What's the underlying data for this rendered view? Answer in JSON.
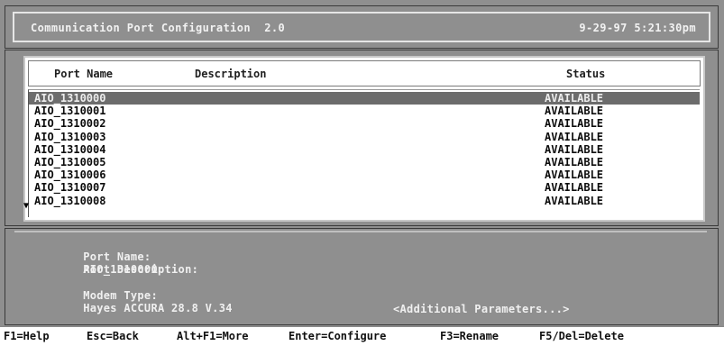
{
  "title": {
    "app": "Communication Port Configuration  2.0",
    "datetime": "9-29-97 5:21:30pm"
  },
  "list": {
    "headers": {
      "port_name": "Port Name",
      "description": "Description",
      "status": "Status"
    },
    "rows": [
      {
        "port_name": "AIO_1310000",
        "status": "AVAILABLE",
        "selected": true
      },
      {
        "port_name": "AIO_1310001",
        "status": "AVAILABLE"
      },
      {
        "port_name": "AIO_1310002",
        "status": "AVAILABLE"
      },
      {
        "port_name": "AIO_1310003",
        "status": "AVAILABLE"
      },
      {
        "port_name": "AIO_1310004",
        "status": "AVAILABLE"
      },
      {
        "port_name": "AIO_1310005",
        "status": "AVAILABLE"
      },
      {
        "port_name": "AIO_1310006",
        "status": "AVAILABLE"
      },
      {
        "port_name": "AIO_1310007",
        "status": "AVAILABLE"
      },
      {
        "port_name": "AIO_1310008",
        "status": "AVAILABLE"
      }
    ],
    "scroll_icon": "down-triangle-icon"
  },
  "detail": {
    "port_name_label": "Port Name:",
    "port_name_value": "AIO_1310000",
    "port_description_label": "Port Description:",
    "modem_type_label": "Modem Type:",
    "modem_type_value": "Hayes ACCURA 28.8 V.34",
    "additional_params": "<Additional Parameters...>"
  },
  "fkeys": [
    "F1=Help",
    "Esc=Back",
    "Alt+F1=More",
    "Enter=Configure",
    "F3=Rename",
    "F5/Del=Delete"
  ],
  "colors": {
    "panel": "#8f8f8f",
    "selection": "#6c6c6c",
    "list_bg": "#ffffff"
  }
}
